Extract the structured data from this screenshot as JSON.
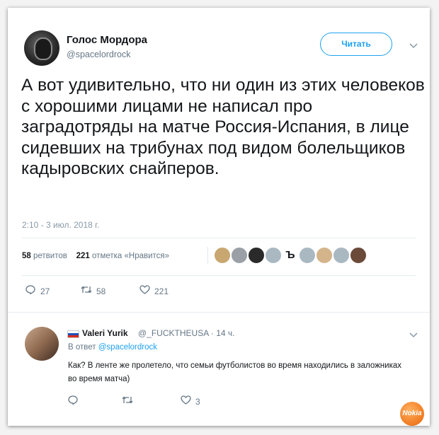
{
  "author": {
    "name": "Голос Мордора",
    "handle": "@spacelordrock"
  },
  "follow_button": "Читать",
  "menu_chevron": "chevron-down-icon",
  "tweet": {
    "text": "А вот удивительно, что ни один из этих человеков с хорошими лицами не написал про заградотряды на матче Россия-Испания, в лице сидевших на трибунах под видом болельщиков кадыровских снайперов.",
    "timestamp": "2:10 - 3 июл. 2018 г."
  },
  "stats": {
    "retweets_count": "58",
    "retweets_label": "ретвитов",
    "likes_count": "221",
    "likes_label": "отметка «Нравится»"
  },
  "actions": {
    "reply_icon": "reply-icon",
    "reply_count": "27",
    "retweet_icon": "retweet-icon",
    "retweet_count": "58",
    "like_icon": "heart-icon",
    "like_count": "221"
  },
  "reply": {
    "name": "Valeri Yurik",
    "handle": "@_FUCKTHEUSA · 14 ч.",
    "reply_to_prefix": "В ответ",
    "reply_to_handle": "@spacelordrock",
    "text": "Как? В ленте же пролетело, что семьи футболистов во время находились в заложниках во время матча)",
    "like_count": "3"
  },
  "liker_avatar_glyph": "Ъ",
  "watermark": "Nokia",
  "colors": {
    "accent": "#1da1f2",
    "text": "#14171a",
    "muted": "#657786"
  }
}
